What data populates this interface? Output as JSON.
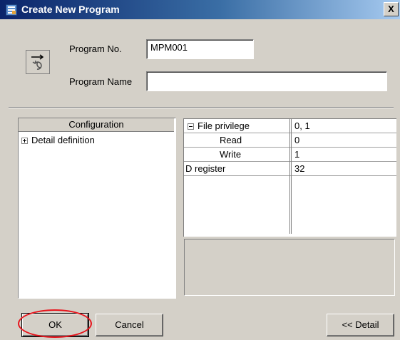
{
  "window": {
    "title": "Create New Program",
    "close_glyph": "X",
    "icon": "app-window-icon"
  },
  "form": {
    "program_icon": "program-refresh-icon",
    "program_no_label": "Program No.",
    "program_no_value": "MPM001",
    "program_name_label": "Program Name",
    "program_name_value": ""
  },
  "left_panel": {
    "header": "Configuration",
    "items": [
      {
        "label": "Detail definition",
        "expander": "+"
      }
    ]
  },
  "grid": {
    "rows": [
      {
        "name": "File privilege",
        "value": "0, 1",
        "expander": "-",
        "indent": false
      },
      {
        "name": "Read",
        "value": "0",
        "expander": "",
        "indent": true
      },
      {
        "name": "Write",
        "value": "1",
        "expander": "",
        "indent": true
      },
      {
        "name": "D register",
        "value": "32",
        "expander": "",
        "indent": false
      }
    ]
  },
  "buttons": {
    "ok": "OK",
    "cancel": "Cancel",
    "detail": "<< Detail"
  },
  "colors": {
    "titlebar_start": "#0a246a",
    "titlebar_end": "#a6caf0",
    "highlight_ring": "#e8141c",
    "window_bg": "#d4d0c8"
  }
}
